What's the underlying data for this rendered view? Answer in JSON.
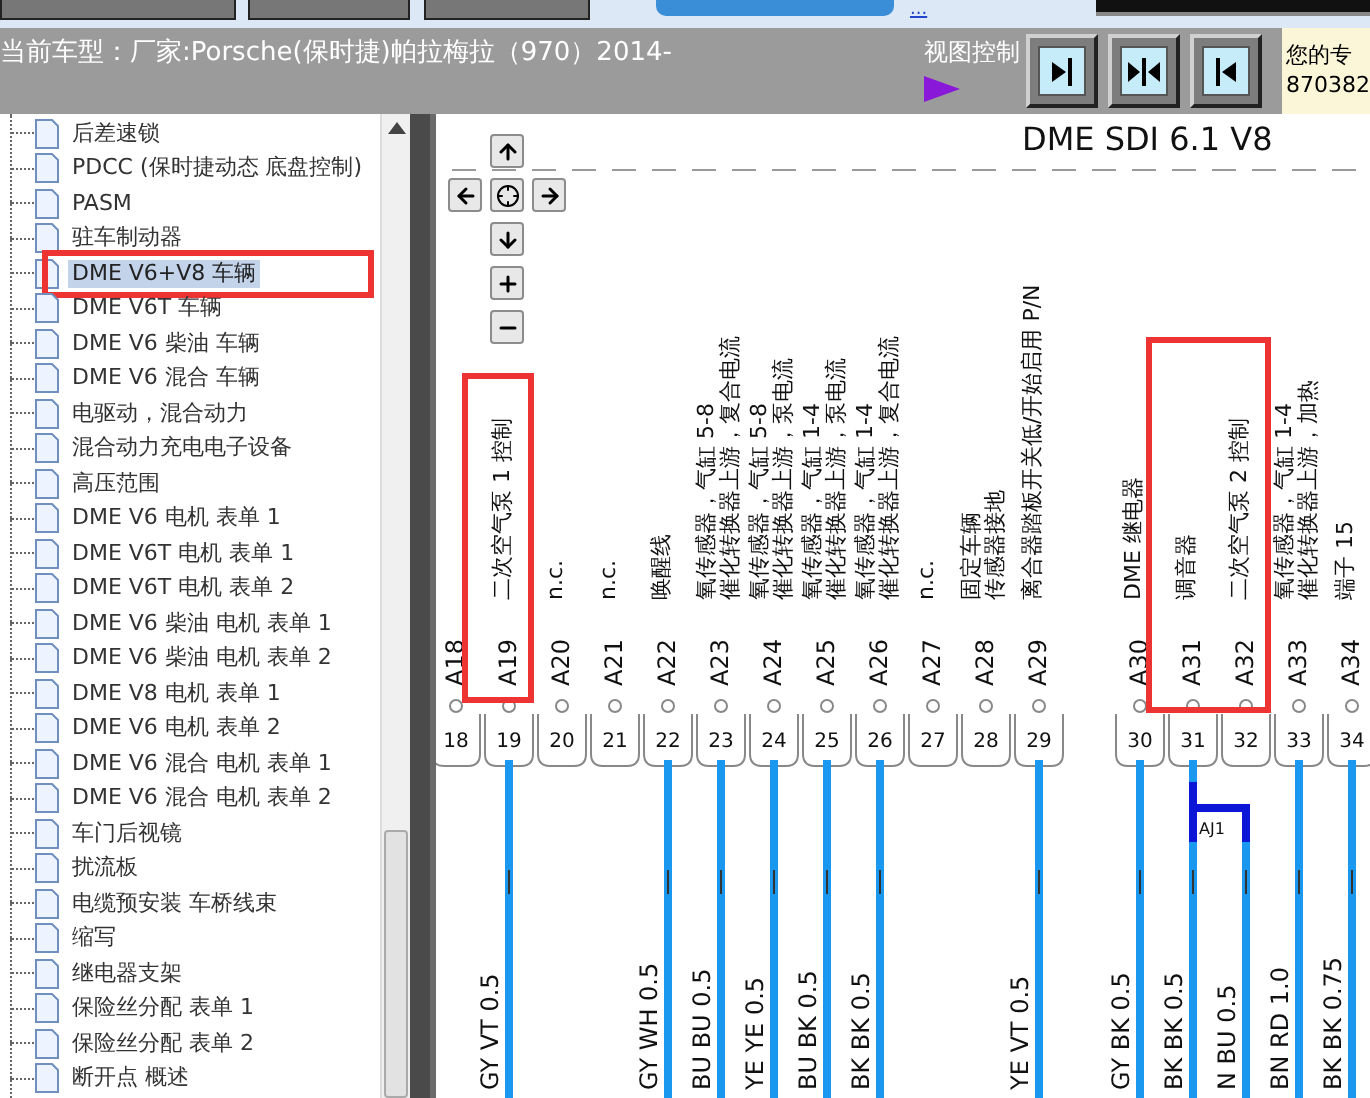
{
  "top_bar": {
    "link": "..."
  },
  "header": {
    "vehicle": "当前车型：厂家:Porsche(保时捷)帕拉梅拉（970）2014-",
    "view_control": "视图控制",
    "user_line_1": "您的专",
    "user_line_2": "870382"
  },
  "tree": [
    {
      "label": "后差速锁",
      "selected": false
    },
    {
      "label": "PDCC (保时捷动态 底盘控制)",
      "selected": false
    },
    {
      "label": "PASM",
      "selected": false
    },
    {
      "label": "驻车制动器",
      "selected": false
    },
    {
      "label": "DME V6+V8 车辆",
      "selected": true
    },
    {
      "label": "DME V6T 车辆",
      "selected": false
    },
    {
      "label": "DME V6 柴油 车辆",
      "selected": false
    },
    {
      "label": "DME V6 混合 车辆",
      "selected": false
    },
    {
      "label": "电驱动，混合动力",
      "selected": false
    },
    {
      "label": "混合动力充电电子设备",
      "selected": false
    },
    {
      "label": "高压范围",
      "selected": false
    },
    {
      "label": "DME V6 电机 表单 1",
      "selected": false
    },
    {
      "label": "DME V6T 电机 表单 1",
      "selected": false
    },
    {
      "label": "DME V6T 电机 表单 2",
      "selected": false
    },
    {
      "label": "DME V6 柴油 电机 表单 1",
      "selected": false
    },
    {
      "label": "DME V6 柴油 电机 表单 2",
      "selected": false
    },
    {
      "label": "DME V8 电机 表单 1",
      "selected": false
    },
    {
      "label": "DME V6 电机 表单 2",
      "selected": false
    },
    {
      "label": "DME V6 混合 电机 表单 1",
      "selected": false
    },
    {
      "label": "DME V6 混合 电机 表单 2",
      "selected": false
    },
    {
      "label": "车门后视镜",
      "selected": false
    },
    {
      "label": "扰流板",
      "selected": false
    },
    {
      "label": "电缆预安装 车桥线束",
      "selected": false
    },
    {
      "label": "缩写",
      "selected": false
    },
    {
      "label": "继电器支架",
      "selected": false
    },
    {
      "label": "保险丝分配 表单 1",
      "selected": false
    },
    {
      "label": "保险丝分配 表单 2",
      "selected": false
    },
    {
      "label": "断开点 概述",
      "selected": false
    }
  ],
  "diagram": {
    "title": "DME SDI 6.1 V8",
    "splice_label": "AJ1",
    "pin_groups": [
      [
        {
          "pin": "A18",
          "number": "18",
          "highlighted": false
        },
        {
          "pin": "A19",
          "number": "19",
          "lines": [
            "二次空气泵 1 控制"
          ],
          "wire": {
            "label": "GY VT 0.5",
            "kind": "direct"
          },
          "highlighted": true
        },
        {
          "pin": "A20",
          "number": "20",
          "lines": [
            "n.c."
          ],
          "highlighted": false
        },
        {
          "pin": "A21",
          "number": "21",
          "lines": [
            "n.c."
          ],
          "highlighted": false
        },
        {
          "pin": "A22",
          "number": "22",
          "lines": [
            "唤醒线"
          ],
          "wire": {
            "label": "GY WH 0.5",
            "kind": "direct"
          },
          "highlighted": false
        },
        {
          "pin": "A23",
          "number": "23",
          "lines": [
            "氧传感器，气缸 5-8",
            "催化转换器上游，复合电流"
          ],
          "wire": {
            "label": "BU BU 0.5",
            "kind": "direct"
          },
          "highlighted": false
        },
        {
          "pin": "A24",
          "number": "24",
          "lines": [
            "氧传感器，气缸 5-8",
            "催化转换器上游，泵电流"
          ],
          "wire": {
            "label": "YE YE 0.5",
            "kind": "direct"
          },
          "highlighted": false
        },
        {
          "pin": "A25",
          "number": "25",
          "lines": [
            "氧传感器，气缸 1-4",
            "催化转换器上游，泵电流"
          ],
          "wire": {
            "label": "BU BK 0.5",
            "kind": "direct"
          },
          "highlighted": false
        },
        {
          "pin": "A26",
          "number": "26",
          "lines": [
            "氧传感器，气缸 1-4",
            "催化转换器上游，复合电流"
          ],
          "wire": {
            "label": "BK BK 0.5",
            "kind": "direct"
          },
          "highlighted": false
        },
        {
          "pin": "A27",
          "number": "27",
          "lines": [
            "n.c."
          ],
          "highlighted": false
        },
        {
          "pin": "A28",
          "number": "28",
          "lines": [
            "固定车辆",
            "传感器接地"
          ],
          "highlighted": false
        },
        {
          "pin": "A29",
          "number": "29",
          "lines": [
            "离合器踏板开关低/开始启用 P/N"
          ],
          "wire": {
            "label": "YE VT 0.5",
            "kind": "direct"
          },
          "highlighted": false
        }
      ],
      [
        {
          "pin": "A30",
          "number": "30",
          "lines": [
            "DME 继电器"
          ],
          "wire": {
            "label": "GY BK 0.5",
            "kind": "direct"
          },
          "highlighted": false
        },
        {
          "pin": "A31",
          "number": "31",
          "lines": [
            "调音器"
          ],
          "wire": {
            "label": "BK BK 0.5",
            "kind": "direct"
          },
          "highlighted": true
        },
        {
          "pin": "A32",
          "number": "32",
          "lines": [
            "二次空气泵 2 控制"
          ],
          "wire": {
            "label": "N BU 0.5",
            "kind": "splice"
          },
          "highlighted": true
        },
        {
          "pin": "A33",
          "number": "33",
          "lines": [
            "氧传感器，气缸 1-4",
            "催化转换器上游，加热"
          ],
          "wire": {
            "label": "BN RD 1.0",
            "kind": "direct"
          },
          "highlighted": false
        },
        {
          "pin": "A34",
          "number": "34",
          "lines": [
            "端子 15"
          ],
          "wire": {
            "label": "BK BK 0.75",
            "kind": "direct"
          },
          "highlighted": false
        }
      ]
    ]
  }
}
